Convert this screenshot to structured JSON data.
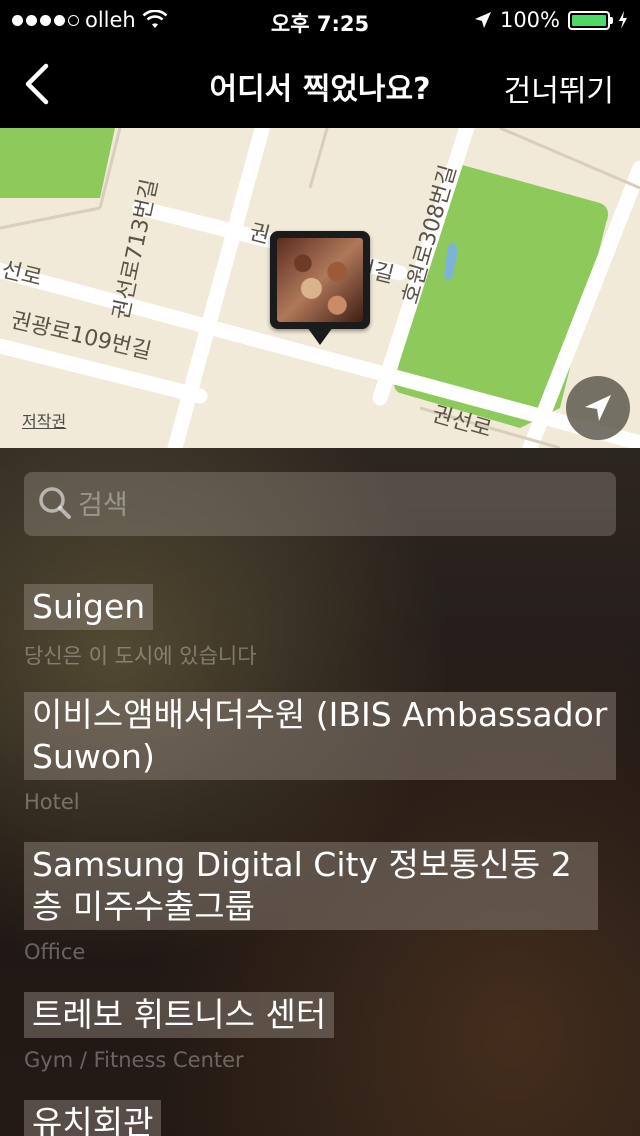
{
  "status_bar": {
    "carrier": "olleh",
    "time": "오후 7:25",
    "battery": "100%"
  },
  "nav": {
    "title": "어디서 찍었나요?",
    "skip_label": "건너뛰기"
  },
  "map": {
    "copyright": "저작권",
    "street_labels": [
      "권선로713번길",
      "호원로308번길",
      "권광로109번길",
      "권선로",
      "선로",
      "권",
      "번길"
    ]
  },
  "search": {
    "placeholder": "검색"
  },
  "places": [
    {
      "name": "Suigen",
      "sub": "당신은 이 도시에 있습니다"
    },
    {
      "name": "이비스앰배서더수원 (IBIS Ambassador Suwon)",
      "sub": "Hotel"
    },
    {
      "name": "Samsung Digital City 정보통신동 2층 미주수출그룹",
      "sub": "Office"
    },
    {
      "name": "트레보 휘트니스 센터",
      "sub": "Gym / Fitness Center"
    },
    {
      "name": "유치회관",
      "sub": ""
    }
  ],
  "colors": {
    "map_bg": "#f1ead8",
    "park": "#8ec95c",
    "battery": "#4cd964"
  }
}
